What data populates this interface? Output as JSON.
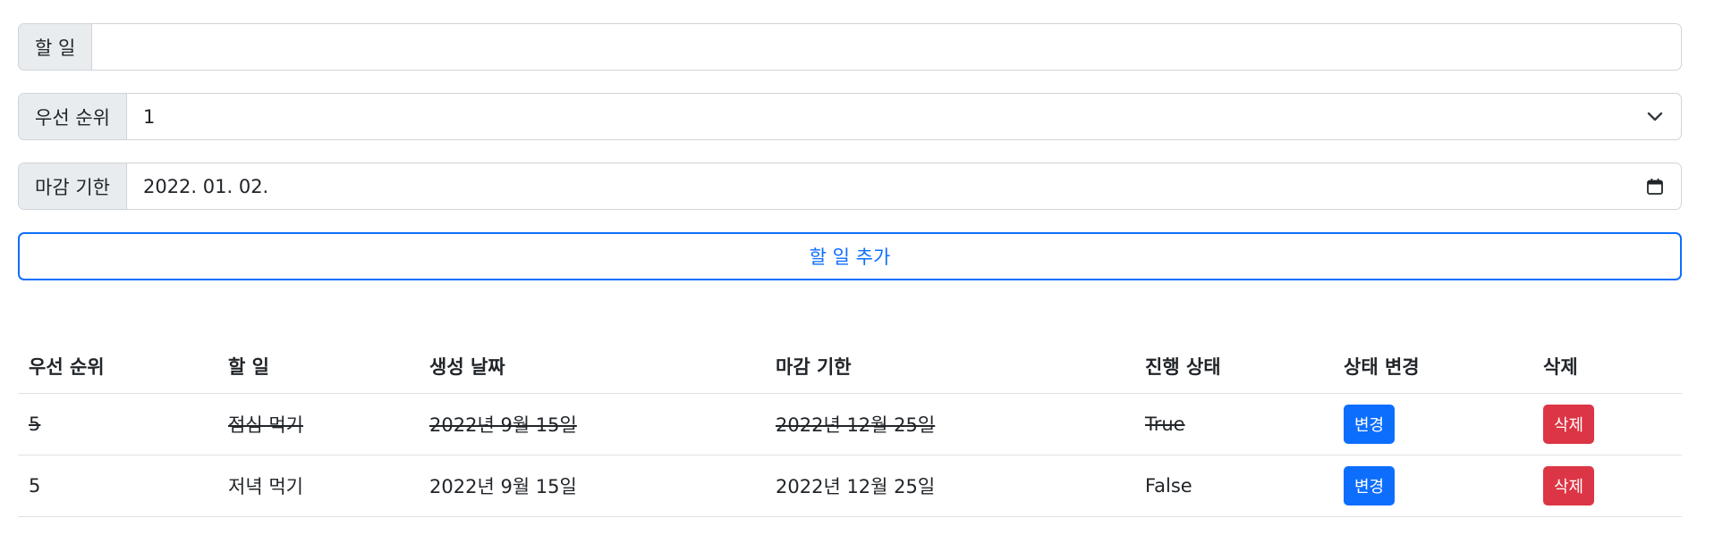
{
  "form": {
    "task_label": "할 일",
    "task_value": "",
    "priority_label": "우선 순위",
    "priority_value": "1",
    "deadline_label": "마감 기한",
    "deadline_value": "2022. 01. 02.",
    "add_button": "할 일 추가"
  },
  "table": {
    "headers": [
      "우선 순위",
      "할 일",
      "생성 날짜",
      "마감 기한",
      "진행 상태",
      "상태 변경",
      "삭제"
    ],
    "rows": [
      {
        "priority": "5",
        "task": "점심 먹기",
        "created": "2022년 9월 15일",
        "deadline": "2022년 12월 25일",
        "status": "True",
        "change": "변경",
        "delete": "삭제",
        "done": true
      },
      {
        "priority": "5",
        "task": "저녁 먹기",
        "created": "2022년 9월 15일",
        "deadline": "2022년 12월 25일",
        "status": "False",
        "change": "변경",
        "delete": "삭제",
        "done": false
      }
    ]
  },
  "icons": {
    "select": "chevron-down-icon",
    "date": "calendar-icon"
  },
  "colors": {
    "primary": "#0d6efd",
    "danger": "#dc3545"
  }
}
